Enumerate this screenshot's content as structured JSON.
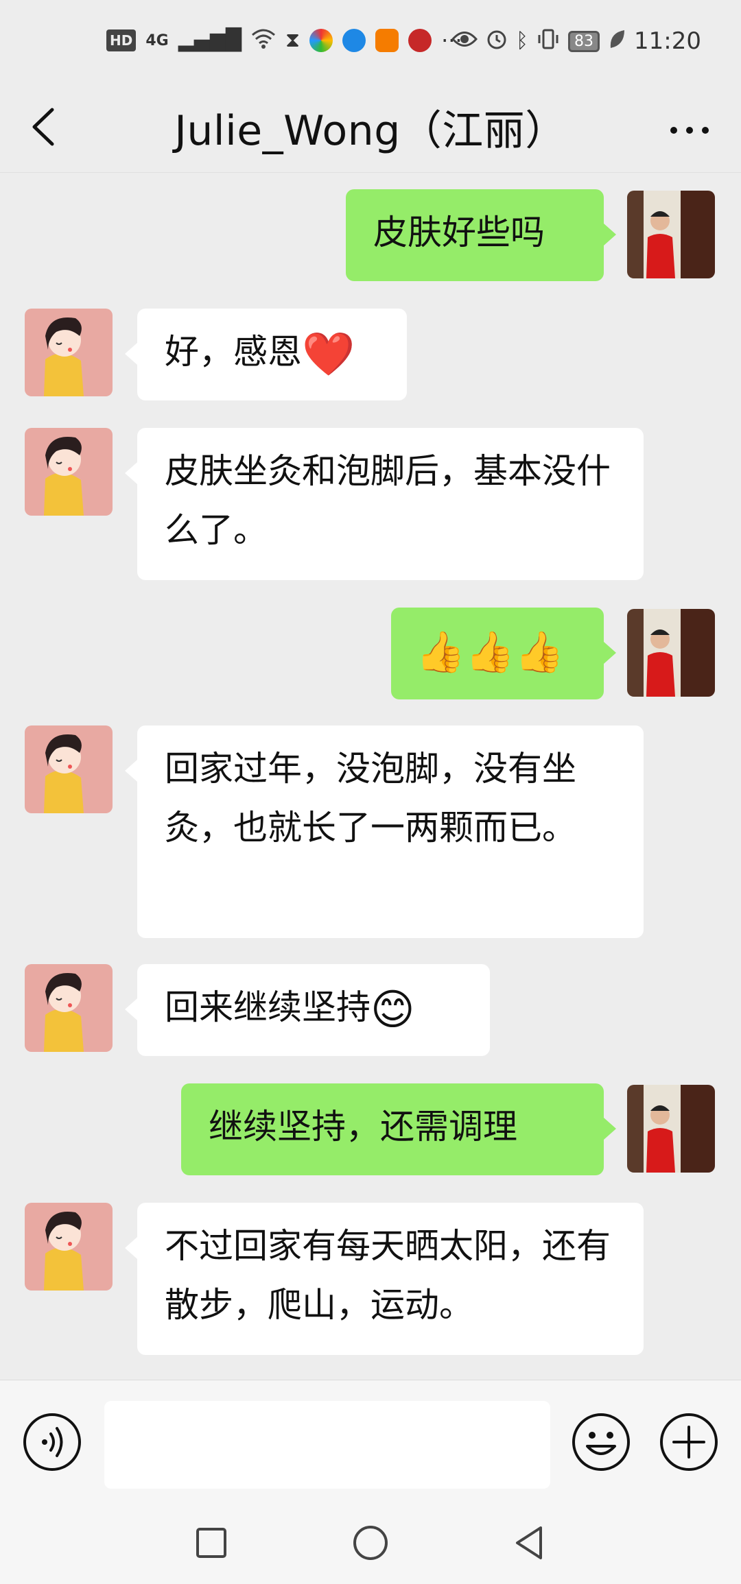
{
  "status_bar": {
    "network_badge": "HD",
    "network_type": "4G",
    "more_indicator": "···",
    "battery": "83",
    "time": "11:20"
  },
  "header": {
    "title": "Julie_Wong（江丽）"
  },
  "messages": [
    {
      "side": "out",
      "text": "皮肤好些吗"
    },
    {
      "side": "in",
      "text": "好，感恩",
      "emoji": "❤️"
    },
    {
      "side": "in",
      "text": "皮肤坐灸和泡脚后，基本没什么了。"
    },
    {
      "side": "out",
      "emoji": "👍👍👍"
    },
    {
      "side": "in",
      "text": "回家过年，没泡脚，没有坐灸，也就长了一两颗而已。"
    },
    {
      "side": "in",
      "text": "回来继续坚持",
      "emoji": "😊"
    },
    {
      "side": "out",
      "text": "继续坚持，还需调理"
    },
    {
      "side": "in",
      "text": "不过回家有每天晒太阳，还有散步，爬山，运动。"
    }
  ],
  "colors": {
    "background": "#ededed",
    "outgoing_bubble": "#95ec69",
    "incoming_bubble": "#ffffff"
  },
  "icons": {
    "back": "chevron-left-icon",
    "more": "more-dots-icon",
    "voice": "voice-icon",
    "emoji": "smiley-icon",
    "plus": "plus-icon"
  }
}
